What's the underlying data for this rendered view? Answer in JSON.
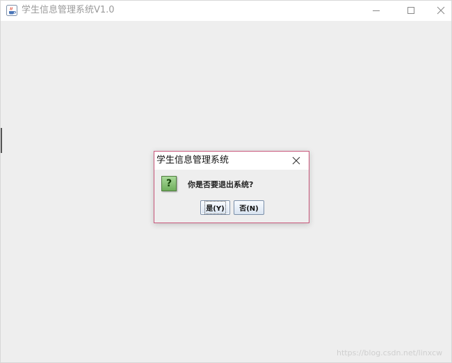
{
  "main_window": {
    "title": "学生信息管理系统V1.0",
    "app_icon": "java-coffee-icon",
    "controls": {
      "minimize_icon": "minimize-icon",
      "maximize_icon": "maximize-icon",
      "close_icon": "close-icon"
    },
    "background_color": "#eeeeee"
  },
  "dialog": {
    "title": "学生信息管理系统",
    "close_icon": "close-icon",
    "icon": "question-icon",
    "icon_glyph": "?",
    "message": "你是否要退出系统?",
    "buttons": {
      "yes_label": "是(Y)",
      "no_label": "否(N)"
    },
    "border_color": "#c8567a"
  },
  "watermark": "https://blog.csdn.net/linxcw"
}
